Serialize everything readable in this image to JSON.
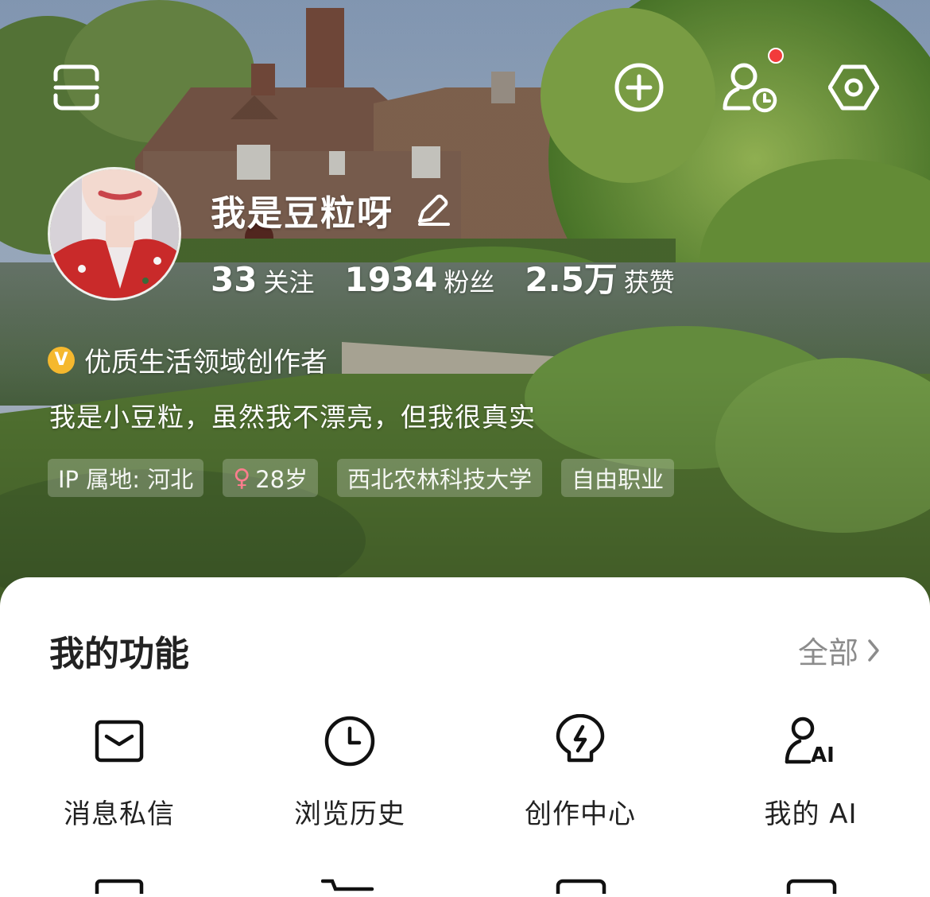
{
  "header": {
    "icons": {
      "scan": "scan-icon",
      "add": "add-circle-icon",
      "visitors": "visitor-icon",
      "settings": "settings-icon"
    },
    "has_notification": true
  },
  "profile": {
    "nickname": "我是豆粒呀",
    "stats": [
      {
        "value": "33",
        "label": "关注"
      },
      {
        "value": "1934",
        "label": "粉丝"
      },
      {
        "value": "2.5万",
        "label": "获赞"
      }
    ],
    "certification": {
      "badge": "V",
      "text": "优质生活领域创作者"
    },
    "bio": "我是小豆粒，虽然我不漂亮，但我很真实",
    "tags": {
      "ip": "IP 属地: 河北",
      "gender_symbol": "♀",
      "age": "28岁",
      "school": "西北农林科技大学",
      "job": "自由职业"
    }
  },
  "features": {
    "title": "我的功能",
    "view_all": "全部",
    "items": [
      {
        "label": "消息私信",
        "icon": "message-icon"
      },
      {
        "label": "浏览历史",
        "icon": "clock-icon"
      },
      {
        "label": "创作中心",
        "icon": "bulb-icon"
      },
      {
        "label": "我的 AI",
        "icon": "ai-user-icon"
      }
    ]
  },
  "colors": {
    "notification_dot": "#f23b3b",
    "verify_badge": "#f5b82e",
    "female": "#ff7d8e",
    "text_dark": "#222222",
    "text_muted": "#8c8c8c"
  }
}
